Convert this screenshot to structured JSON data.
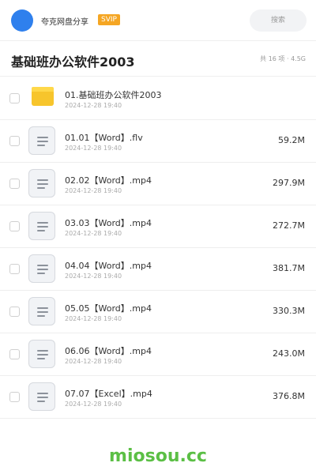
{
  "header": {
    "user_name": "夸克网盘分享",
    "badge": "SVIP",
    "search_placeholder": "搜索"
  },
  "folder": {
    "title": "基础班办公软件2003",
    "summary": "共 16 项 · 4.5G"
  },
  "items": [
    {
      "type": "folder",
      "name": "01.基础班办公软件2003",
      "date": "2024-12-28 19:40",
      "size": ""
    },
    {
      "type": "file",
      "name": "01.01【Word】.flv",
      "date": "2024-12-28 19:40",
      "size": "59.2M"
    },
    {
      "type": "file",
      "name": "02.02【Word】.mp4",
      "date": "2024-12-28 19:40",
      "size": "297.9M"
    },
    {
      "type": "file",
      "name": "03.03【Word】.mp4",
      "date": "2024-12-28 19:40",
      "size": "272.7M"
    },
    {
      "type": "file",
      "name": "04.04【Word】.mp4",
      "date": "2024-12-28 19:40",
      "size": "381.7M"
    },
    {
      "type": "file",
      "name": "05.05【Word】.mp4",
      "date": "2024-12-28 19:40",
      "size": "330.3M"
    },
    {
      "type": "file",
      "name": "06.06【Word】.mp4",
      "date": "2024-12-28 19:40",
      "size": "243.0M"
    },
    {
      "type": "file",
      "name": "07.07【Excel】.mp4",
      "date": "2024-12-28 19:40",
      "size": "376.8M"
    }
  ],
  "footer": {
    "watermark": "miosou.cc"
  },
  "colors": {
    "avatar": "#2f80ed",
    "svip_badge": "#f5a623",
    "folder": "#f7c52c",
    "watermark": "#5bbf45"
  }
}
